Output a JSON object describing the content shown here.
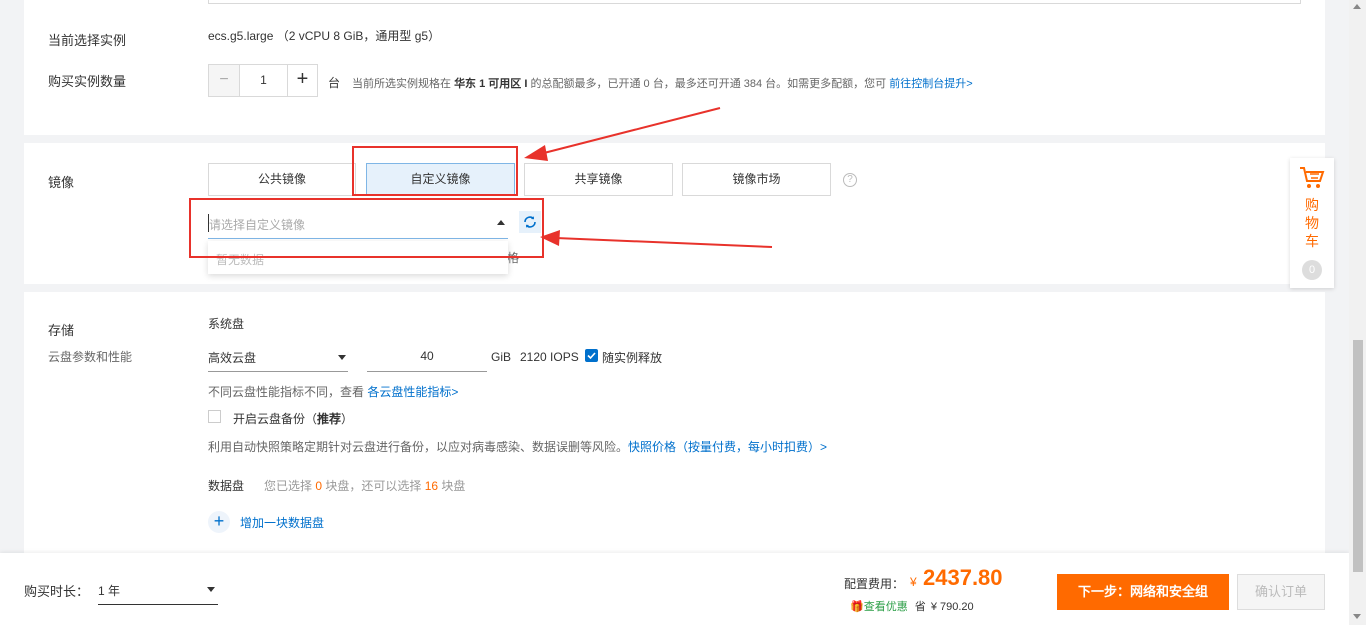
{
  "instance": {
    "current_label": "当前选择实例",
    "current_value": "ecs.g5.large （2 vCPU 8 GiB，通用型 g5）",
    "quantity_label": "购买实例数量",
    "quantity_minus": "−",
    "quantity_value": "1",
    "quantity_plus": "+",
    "quantity_unit": "台",
    "quota_text_prefix": "当前所选实例规格在 ",
    "quota_region": "华东 1 可用区 I",
    "quota_text_suffix": " 的总配额最多，已开通 0 台，最多还可开通 384 台。如需更多配额，您可 ",
    "quota_link": "前往控制台提升>"
  },
  "image": {
    "label": "镜像",
    "tabs": [
      "公共镜像",
      "自定义镜像",
      "共享镜像",
      "镜像市场"
    ],
    "selected_tab": 1,
    "help_icon": "?",
    "select_placeholder": "请选择自定义镜像",
    "dropdown_empty": "暂无数据",
    "trailing_char": "格"
  },
  "storage": {
    "label": "存储",
    "sublabel": "云盘参数和性能",
    "system_disk_label": "系统盘",
    "disk_type": "高效云盘",
    "disk_size": "40",
    "disk_unit": "GiB",
    "iops": "2120 IOPS",
    "release_label": "随实例释放",
    "perf_note": "不同云盘性能指标不同，查看 ",
    "perf_link": "各云盘性能指标>",
    "backup_label_prefix": "开启云盘备份（",
    "backup_label_bold": "推荐",
    "backup_label_suffix": "）",
    "backup_note": "利用自动快照策略定期针对云盘进行备份，以应对病毒感染、数据误删等风险。",
    "backup_link": "快照价格（按量付费，每小时扣费）>",
    "data_disk_label": "数据盘",
    "data_disk_note_1": "您已选择 ",
    "data_disk_selected": "0",
    "data_disk_note_2": " 块盘，还可以选择 ",
    "data_disk_remaining": "16",
    "data_disk_note_3": " 块盘",
    "add_disk_label": "增加一块数据盘"
  },
  "cart": {
    "label": "购物车",
    "count": "0"
  },
  "footer": {
    "duration_label": "购买时长：",
    "duration_value": "1 年",
    "fee_label": "配置费用：",
    "currency": "¥",
    "fee_value": "2437.80",
    "discount_label": "查看优惠",
    "save_label": "省",
    "save_value": "¥ 790.20",
    "next_button": "下一步：网络和安全组",
    "confirm_button": "确认订单"
  },
  "colors": {
    "accent": "#ff6a00",
    "link": "#0070cc",
    "annotation": "#e8322b"
  }
}
